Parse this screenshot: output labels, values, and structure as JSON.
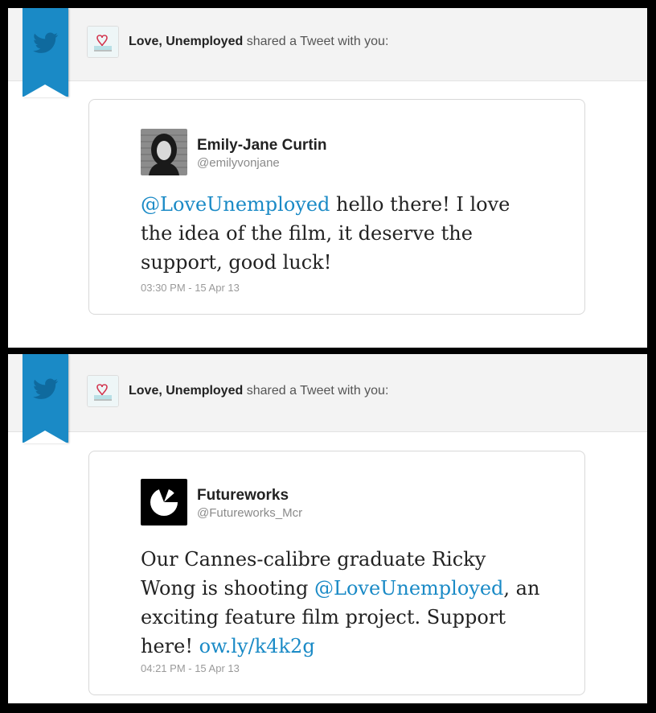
{
  "notifications": [
    {
      "sharer_name": "Love, Unemployed",
      "share_text": "shared a Tweet with you:",
      "tweet": {
        "author_name": "Emily-Jane Curtin",
        "author_handle": "@emilyvonjane",
        "body_mention": "@LoveUnemployed",
        "body_text": " hello there! I love the idea of the film, it deserve the support, good luck!",
        "timestamp": "03:30 PM - 15 Apr 13"
      }
    },
    {
      "sharer_name": "Love, Unemployed",
      "share_text": "shared a Tweet with you:",
      "tweet": {
        "author_name": "Futureworks",
        "author_handle": "@Futureworks_Mcr",
        "body_pre": "Our Cannes-calibre graduate Ricky Wong is shooting ",
        "body_mention": "@LoveUnemployed",
        "body_mid": ", an exciting feature film project. Support here! ",
        "body_link": "ow.ly/k4k2g",
        "timestamp": "04:21 PM - 15 Apr 13"
      }
    }
  ],
  "colors": {
    "twitter_blue": "#1a8ac6",
    "header_bg": "#f3f3f3",
    "link": "#1a8ac6"
  },
  "icons": {
    "ribbon_icon": "twitter-bird-icon",
    "futureworks_logo": "futureworks-logo-icon"
  }
}
